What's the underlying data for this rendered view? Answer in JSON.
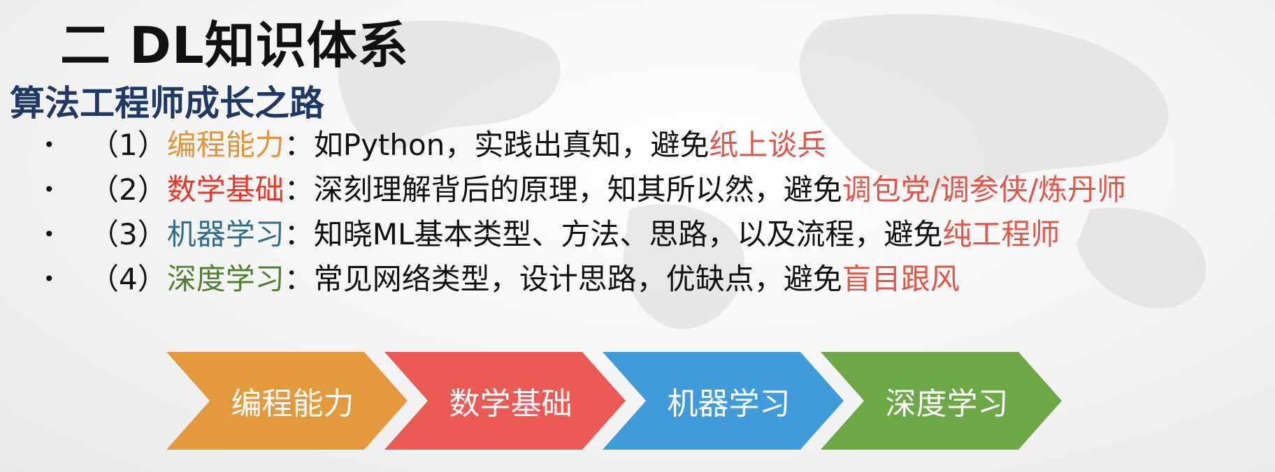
{
  "title": "二 DL知识体系",
  "subtitle": "算法工程师成长之路",
  "bullet_marker": "•",
  "bullets": [
    {
      "num": "（1）",
      "topic": "编程能力",
      "desc": "：如Python，实践出真知，避免",
      "warn": "纸上谈兵",
      "topic_color": "#e3953a"
    },
    {
      "num": "（2）",
      "topic": "数学基础",
      "desc": "：深刻理解背后的原理，知其所以然，避免",
      "warn": "调包党/调参侠/炼丹师",
      "topic_color": "#e8382a"
    },
    {
      "num": "（3）",
      "topic": "机器学习",
      "desc": "：知晓ML基本类型、方法、思路，以及流程，避免",
      "warn": "纯工程师",
      "topic_color": "#2e6e8e"
    },
    {
      "num": "（4）",
      "topic": "深度学习",
      "desc": "：常见网络类型，设计思路，优缺点，避免",
      "warn": "盲目跟风",
      "topic_color": "#4f7f2f"
    }
  ],
  "warn_color": "#e0574a",
  "arrows": [
    {
      "label": "编程能力",
      "color": "#e49a3c"
    },
    {
      "label": "数学基础",
      "color": "#eb5a54"
    },
    {
      "label": "机器学习",
      "color": "#3f9bd9"
    },
    {
      "label": "深度学习",
      "color": "#6ea746"
    }
  ]
}
